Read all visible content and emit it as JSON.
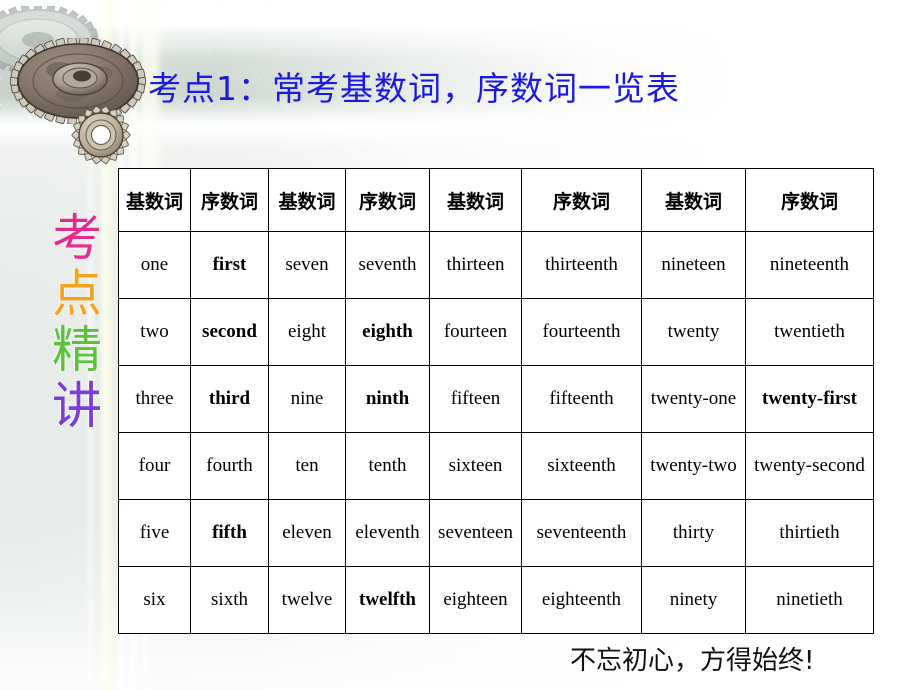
{
  "slide": {
    "heading": "考点1：常考基数词，序数词一览表",
    "footer": "不忘初心，方得始终!",
    "side_title_chars": [
      {
        "char": "考",
        "color": "#e8288f"
      },
      {
        "char": "点",
        "color": "#f5a21c"
      },
      {
        "char": "精",
        "color": "#5cc23a"
      },
      {
        "char": "讲",
        "color": "#7b3fd4"
      }
    ],
    "colors": {
      "heading": "#1a1ae2",
      "table_border": "#000000",
      "table_bg": "#ffffff",
      "footer": "#111111",
      "background_band": "#c6d1ca",
      "background_page": "#e7ece8"
    },
    "decorations": {
      "gear_large": "gear-icon",
      "gear_small": "gear-icon",
      "gear_faint": "gear-icon"
    }
  },
  "table": {
    "headers": [
      "基数词",
      "序数词",
      "基数词",
      "序数词",
      "基数词",
      "序数词",
      "基数词",
      "序数词"
    ],
    "rows": [
      [
        {
          "text": "one",
          "bold": false
        },
        {
          "text": "first",
          "bold": true
        },
        {
          "text": "seven",
          "bold": false
        },
        {
          "text": "seventh",
          "bold": false
        },
        {
          "text": "thirteen",
          "bold": false
        },
        {
          "text": "thirteenth",
          "bold": false
        },
        {
          "text": "nineteen",
          "bold": false
        },
        {
          "text": "nineteenth",
          "bold": false
        }
      ],
      [
        {
          "text": "two",
          "bold": false
        },
        {
          "text": "second",
          "bold": true
        },
        {
          "text": "eight",
          "bold": false
        },
        {
          "text": "eighth",
          "bold": true
        },
        {
          "text": "fourteen",
          "bold": false
        },
        {
          "text": "fourteenth",
          "bold": false
        },
        {
          "text": "twenty",
          "bold": false
        },
        {
          "text": "twentieth",
          "bold": false
        }
      ],
      [
        {
          "text": "three",
          "bold": false
        },
        {
          "text": "third",
          "bold": true
        },
        {
          "text": "nine",
          "bold": false
        },
        {
          "text": "ninth",
          "bold": true
        },
        {
          "text": "fifteen",
          "bold": false
        },
        {
          "text": "fifteenth",
          "bold": false
        },
        {
          "text": "twenty-one",
          "bold": false
        },
        {
          "text": "twenty-first",
          "bold": true
        }
      ],
      [
        {
          "text": "four",
          "bold": false
        },
        {
          "text": "fourth",
          "bold": false
        },
        {
          "text": "ten",
          "bold": false
        },
        {
          "text": "tenth",
          "bold": false
        },
        {
          "text": "sixteen",
          "bold": false
        },
        {
          "text": "sixteenth",
          "bold": false
        },
        {
          "text": "twenty-two",
          "bold": false
        },
        {
          "text": "twenty-second",
          "bold": false
        }
      ],
      [
        {
          "text": "five",
          "bold": false
        },
        {
          "text": "fifth",
          "bold": true
        },
        {
          "text": "eleven",
          "bold": false
        },
        {
          "text": "eleventh",
          "bold": false
        },
        {
          "text": "seventeen",
          "bold": false
        },
        {
          "text": "seventeenth",
          "bold": false
        },
        {
          "text": "thirty",
          "bold": false
        },
        {
          "text": "thirtieth",
          "bold": false
        }
      ],
      [
        {
          "text": "six",
          "bold": false
        },
        {
          "text": "sixth",
          "bold": false
        },
        {
          "text": "twelve",
          "bold": false
        },
        {
          "text": "twelfth",
          "bold": true
        },
        {
          "text": "eighteen",
          "bold": false
        },
        {
          "text": "eighteenth",
          "bold": false
        },
        {
          "text": "ninety",
          "bold": false
        },
        {
          "text": "ninetieth",
          "bold": false
        }
      ]
    ]
  }
}
